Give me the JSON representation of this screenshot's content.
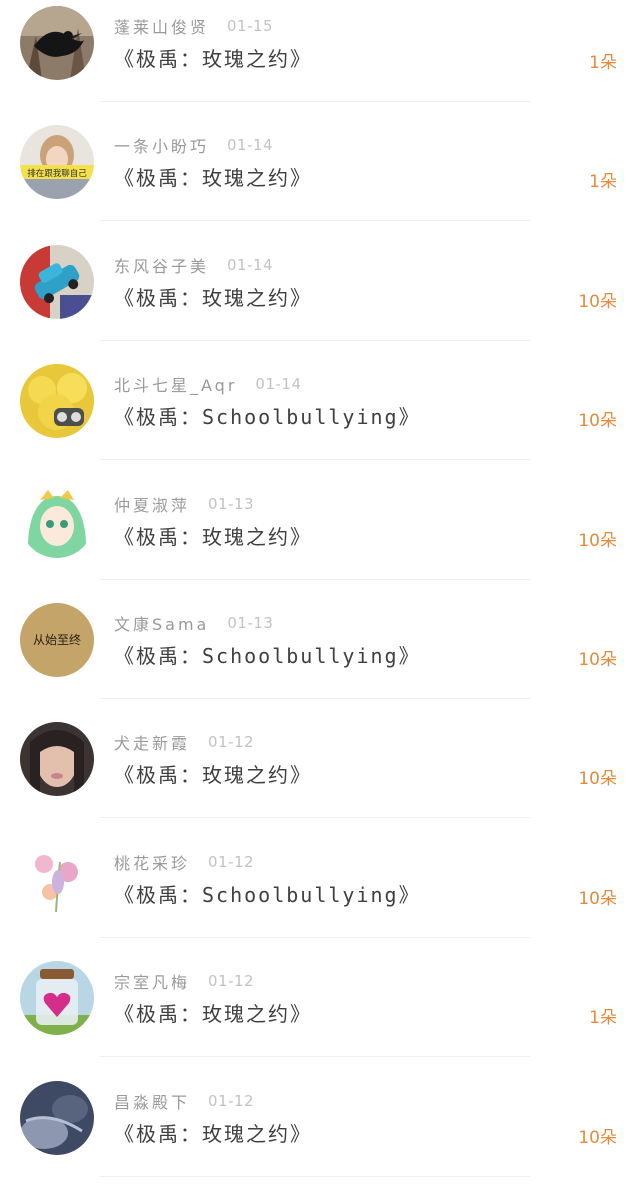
{
  "list": {
    "items": [
      {
        "name": "蓬莱山俊贤",
        "date": "01-15",
        "title": "《极禹：玫瑰之约》",
        "count": "1朵"
      },
      {
        "name": "一条小盼巧",
        "date": "01-14",
        "title": "《极禹：玫瑰之约》",
        "count": "1朵"
      },
      {
        "name": "东风谷子美",
        "date": "01-14",
        "title": "《极禹：玫瑰之约》",
        "count": "10朵"
      },
      {
        "name": "北斗七星_Aqr",
        "date": "01-14",
        "title": "《极禹：Schoolbullying》",
        "count": "10朵"
      },
      {
        "name": "仲夏淑萍",
        "date": "01-13",
        "title": "《极禹：玫瑰之约》",
        "count": "10朵"
      },
      {
        "name": "文康Sama",
        "date": "01-13",
        "title": "《极禹：Schoolbullying》",
        "count": "10朵"
      },
      {
        "name": "犬走新霞",
        "date": "01-12",
        "title": "《极禹：玫瑰之约》",
        "count": "10朵"
      },
      {
        "name": "桃花采珍",
        "date": "01-12",
        "title": "《极禹：Schoolbullying》",
        "count": "10朵"
      },
      {
        "name": "宗室凡梅",
        "date": "01-12",
        "title": "《极禹：玫瑰之约》",
        "count": "1朵"
      },
      {
        "name": "昌淼殿下",
        "date": "01-12",
        "title": "《极禹：玫瑰之约》",
        "count": "10朵"
      }
    ],
    "avatar_texts": {
      "item_1": "排在跟我聊自己",
      "item_5": "从始至终"
    }
  },
  "colors": {
    "name": "#9a9a9a",
    "date": "#c3c3c3",
    "title": "#3f3f3f",
    "count": "#e78a3c",
    "divider": "#efefef"
  }
}
